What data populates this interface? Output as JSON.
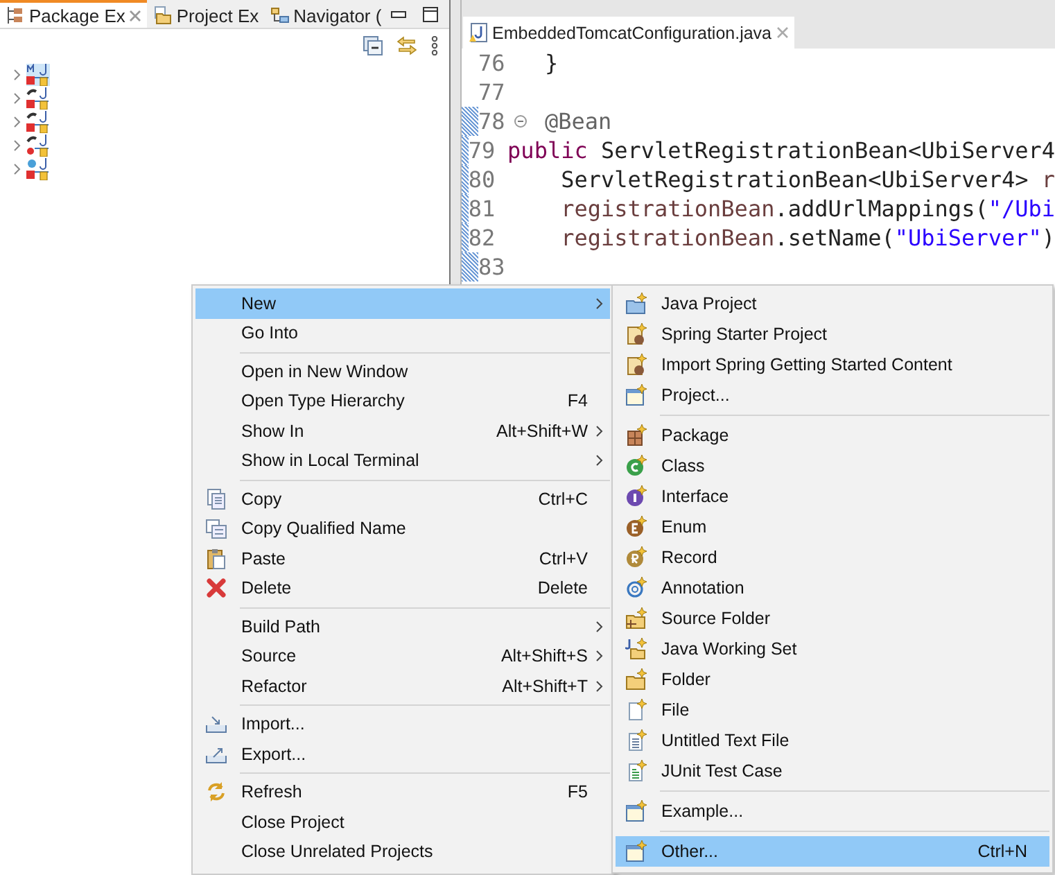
{
  "left_panel": {
    "tabs": [
      {
        "label": "Package Ex",
        "selected": true,
        "closable": true
      },
      {
        "label": "Project Ex",
        "selected": false,
        "closable": false
      },
      {
        "label": "Navigator (",
        "selected": false,
        "closable": false
      }
    ],
    "tree": [
      {
        "selected": true,
        "kind": "maven"
      },
      {
        "selected": false,
        "kind": "spring"
      },
      {
        "selected": false,
        "kind": "spring"
      },
      {
        "selected": false,
        "kind": "spring-error"
      },
      {
        "selected": false,
        "kind": "web"
      }
    ]
  },
  "editor": {
    "tab": {
      "label": "EmbeddedTomcatConfiguration.java",
      "selected": true
    },
    "lines": [
      {
        "number": "76",
        "changed": false,
        "foldable": false,
        "segments": [
          {
            "text": "}",
            "kind": "plain"
          }
        ]
      },
      {
        "number": "77",
        "changed": false,
        "foldable": false
      },
      {
        "number": "78",
        "changed": true,
        "foldable": true,
        "segments": [
          {
            "text": "@Bean",
            "kind": "annotation"
          }
        ]
      },
      {
        "number": "79",
        "changed": true,
        "foldable": false,
        "segments": [
          {
            "text": "public",
            "kind": "keyword"
          },
          {
            "text": " ServletRegistrationBean<UbiServer4",
            "kind": "plain"
          }
        ]
      },
      {
        "number": "80",
        "changed": true,
        "foldable": false,
        "segments": [
          {
            "text": "    ServletRegistrationBean<UbiServer4> ",
            "kind": "plain"
          },
          {
            "text": "r",
            "kind": "variable"
          }
        ]
      },
      {
        "number": "81",
        "changed": true,
        "foldable": false,
        "segments": [
          {
            "text": "    registrationBean",
            "kind": "variable"
          },
          {
            "text": ".addUrlMappings(",
            "kind": "plain"
          },
          {
            "text": "\"/Ubi",
            "kind": "string"
          }
        ]
      },
      {
        "number": "82",
        "changed": true,
        "foldable": false,
        "segments": [
          {
            "text": "    registrationBean",
            "kind": "variable"
          },
          {
            "text": ".setName(",
            "kind": "plain"
          },
          {
            "text": "\"UbiServer\"",
            "kind": "string"
          },
          {
            "text": ")",
            "kind": "plain"
          }
        ]
      },
      {
        "number": "83",
        "changed": true,
        "foldable": false
      }
    ]
  },
  "context_menu": {
    "items": [
      {
        "kind": "plain",
        "label": "New",
        "submenu": true,
        "selected": true
      },
      {
        "kind": "plain",
        "label": "Go Into",
        "submenu": false,
        "selected": false
      },
      {
        "kind": "separator"
      },
      {
        "kind": "plain",
        "label": "Open in New Window",
        "submenu": false,
        "selected": false
      },
      {
        "kind": "plain",
        "label": "Open Type Hierarchy",
        "shortcut": "F4",
        "submenu": false,
        "selected": false
      },
      {
        "kind": "plain",
        "label": "Show In",
        "shortcut": "Alt+Shift+W",
        "submenu": true,
        "selected": false
      },
      {
        "kind": "plain",
        "label": "Show in Local Terminal",
        "submenu": true,
        "selected": false
      },
      {
        "kind": "separator"
      },
      {
        "kind": "copy",
        "label": "Copy",
        "shortcut": "Ctrl+C",
        "submenu": false,
        "selected": false
      },
      {
        "kind": "copy-name",
        "label": "Copy Qualified Name",
        "submenu": false,
        "selected": false
      },
      {
        "kind": "paste",
        "label": "Paste",
        "shortcut": "Ctrl+V",
        "submenu": false,
        "selected": false
      },
      {
        "kind": "delete",
        "label": "Delete",
        "shortcut": "Delete",
        "submenu": false,
        "selected": false
      },
      {
        "kind": "separator"
      },
      {
        "kind": "plain",
        "label": "Build Path",
        "submenu": true,
        "selected": false
      },
      {
        "kind": "plain",
        "label": "Source",
        "shortcut": "Alt+Shift+S",
        "submenu": true,
        "selected": false
      },
      {
        "kind": "plain",
        "label": "Refactor",
        "shortcut": "Alt+Shift+T",
        "submenu": true,
        "selected": false
      },
      {
        "kind": "separator"
      },
      {
        "kind": "import",
        "label": "Import...",
        "submenu": false,
        "selected": false
      },
      {
        "kind": "export",
        "label": "Export...",
        "submenu": false,
        "selected": false
      },
      {
        "kind": "separator"
      },
      {
        "kind": "refresh",
        "label": "Refresh",
        "shortcut": "F5",
        "submenu": false,
        "selected": false
      },
      {
        "kind": "plain",
        "label": "Close Project",
        "submenu": false,
        "selected": false
      },
      {
        "kind": "plain",
        "label": "Close Unrelated Projects",
        "submenu": false,
        "selected": false
      }
    ]
  },
  "submenu": {
    "items": [
      {
        "kind": "java-project",
        "label": "Java Project",
        "selected": false
      },
      {
        "kind": "spring",
        "label": "Spring Starter Project",
        "selected": false
      },
      {
        "kind": "spring",
        "label": "Import Spring Getting Started Content",
        "selected": false
      },
      {
        "kind": "window",
        "label": "Project...",
        "selected": false
      },
      {
        "kind": "separator"
      },
      {
        "kind": "package",
        "label": "Package",
        "selected": false
      },
      {
        "kind": "class",
        "label": "Class",
        "selected": false
      },
      {
        "kind": "interface",
        "label": "Interface",
        "selected": false
      },
      {
        "kind": "enum",
        "label": "Enum",
        "selected": false
      },
      {
        "kind": "record",
        "label": "Record",
        "selected": false
      },
      {
        "kind": "annotation",
        "label": "Annotation",
        "selected": false
      },
      {
        "kind": "source-folder",
        "label": "Source Folder",
        "selected": false
      },
      {
        "kind": "working-set",
        "label": "Java Working Set",
        "selected": false
      },
      {
        "kind": "folder",
        "label": "Folder",
        "selected": false
      },
      {
        "kind": "file",
        "label": "File",
        "selected": false
      },
      {
        "kind": "text-file",
        "label": "Untitled Text File",
        "selected": false
      },
      {
        "kind": "junit",
        "label": "JUnit Test Case",
        "selected": false
      },
      {
        "kind": "separator"
      },
      {
        "kind": "window",
        "label": "Example...",
        "selected": false
      },
      {
        "kind": "separator"
      },
      {
        "kind": "window",
        "label": "Other...",
        "shortcut": "Ctrl+N",
        "selected": true
      }
    ]
  }
}
